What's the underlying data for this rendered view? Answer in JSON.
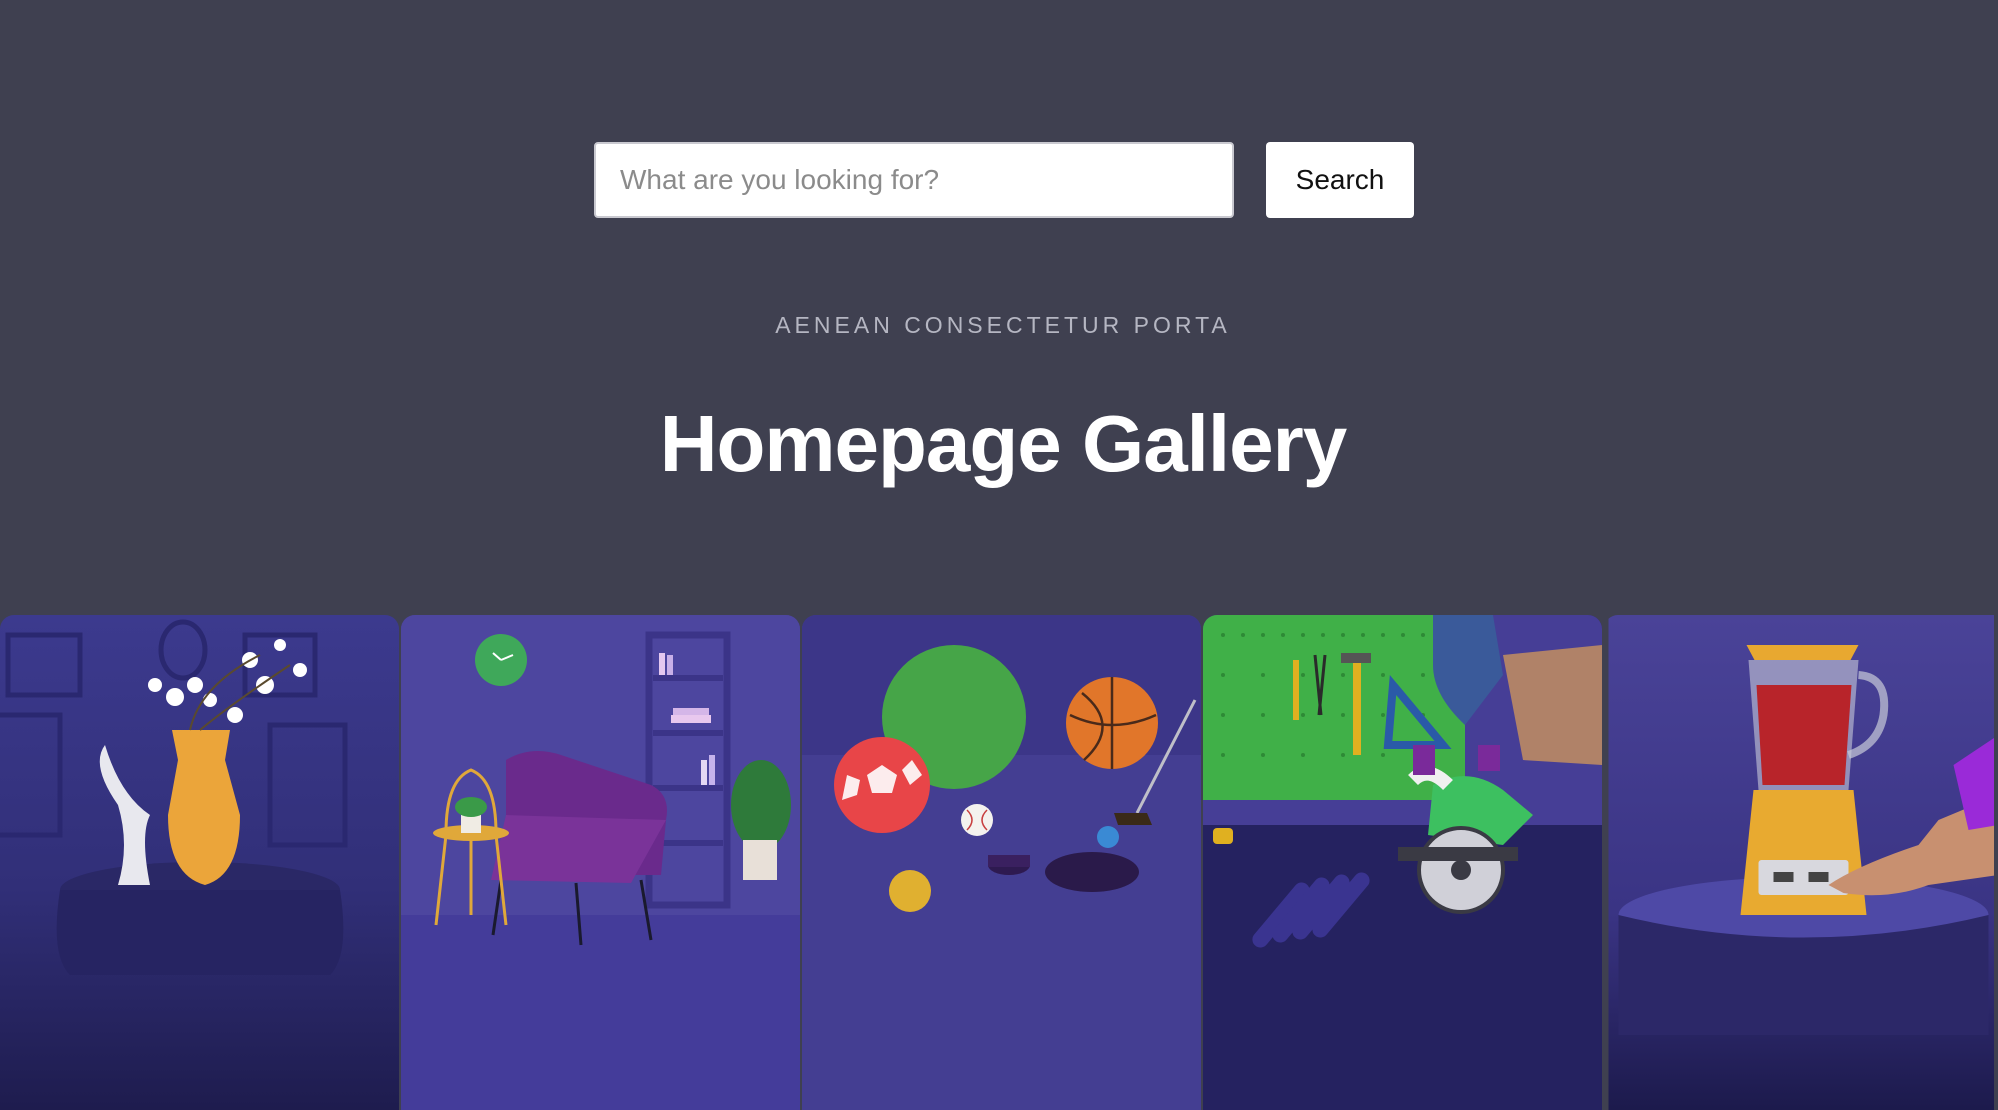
{
  "search": {
    "placeholder": "What are you looking for?",
    "value": "",
    "button_label": "Search"
  },
  "hero": {
    "eyebrow": "AENEAN CONSECTETUR PORTA",
    "title": "Homepage Gallery"
  },
  "gallery": {
    "items": [
      {
        "icon": "vase-image"
      },
      {
        "icon": "armchair-image"
      },
      {
        "icon": "sports-balls-image"
      },
      {
        "icon": "power-tools-image"
      },
      {
        "icon": "blender-image"
      }
    ]
  },
  "colors": {
    "background": "#3f4050",
    "accent_purple": "#4b44a0",
    "white": "#ffffff"
  }
}
